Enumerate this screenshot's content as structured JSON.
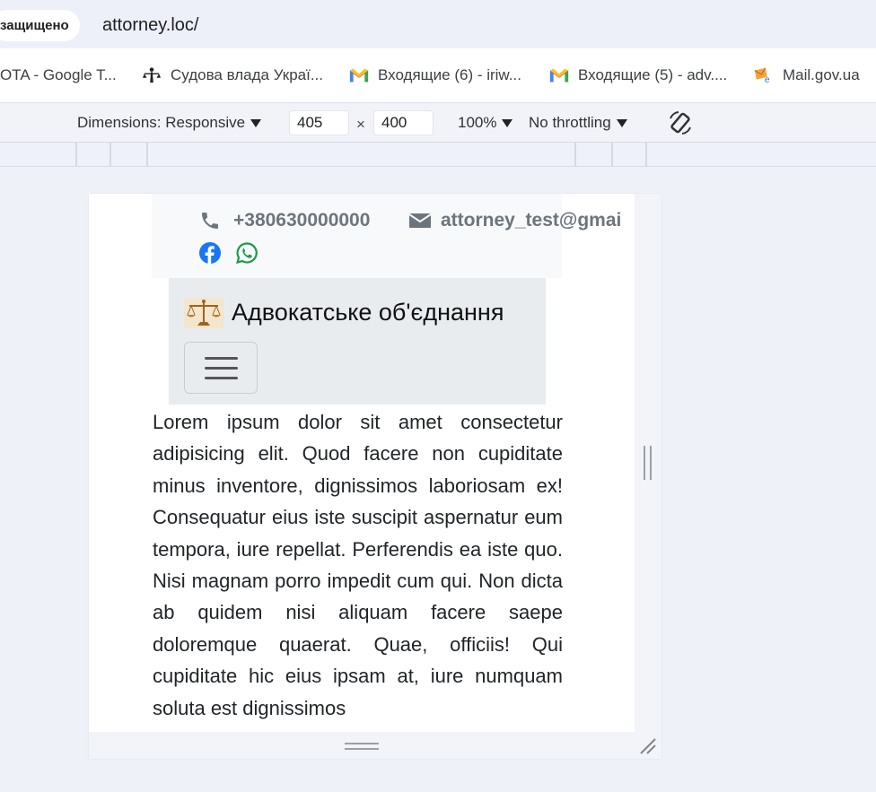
{
  "address_bar": {
    "security_label": "защищено",
    "url": "attorney.loc/"
  },
  "bookmarks": [
    {
      "label": "OTA - Google T...",
      "icon": "none"
    },
    {
      "label": "Судова влада Украї...",
      "icon": "themis-icon"
    },
    {
      "label": "Входящие (6) - iriw...",
      "icon": "gmail-icon"
    },
    {
      "label": "Входящие (5) - adv....",
      "icon": "gmail-icon"
    },
    {
      "label": "Mail.gov.ua",
      "icon": "mail-gov-icon"
    }
  ],
  "device_toolbar": {
    "dimensions_label": "Dimensions: Responsive",
    "width": "405",
    "times": "×",
    "height": "400",
    "zoom": "100%",
    "throttling": "No throttling"
  },
  "page": {
    "phone": "+380630000000",
    "email": "attorney_test@gmai",
    "brand": "Адвокатське об'єднання",
    "body_text": "Lorem ipsum dolor sit amet consectetur adipisicing elit. Quod facere non cupiditate minus inventore, dignissimos laboriosam ex! Consequatur eius iste suscipit aspernatur eum tempora, iure repellat. Perferendis ea iste quo. Nisi magnam porro impedit cum qui. Non dicta ab quidem nisi aliquam facere saepe doloremque quaerat. Quae, officiis! Qui cupiditate hic eius ipsam at, iure numquam soluta est dignissimos"
  },
  "colors": {
    "facebook": "#1877f2",
    "whatsapp": "#1a9a4a",
    "muted": "#6c757d",
    "navbar_bg": "#e9ecef"
  }
}
